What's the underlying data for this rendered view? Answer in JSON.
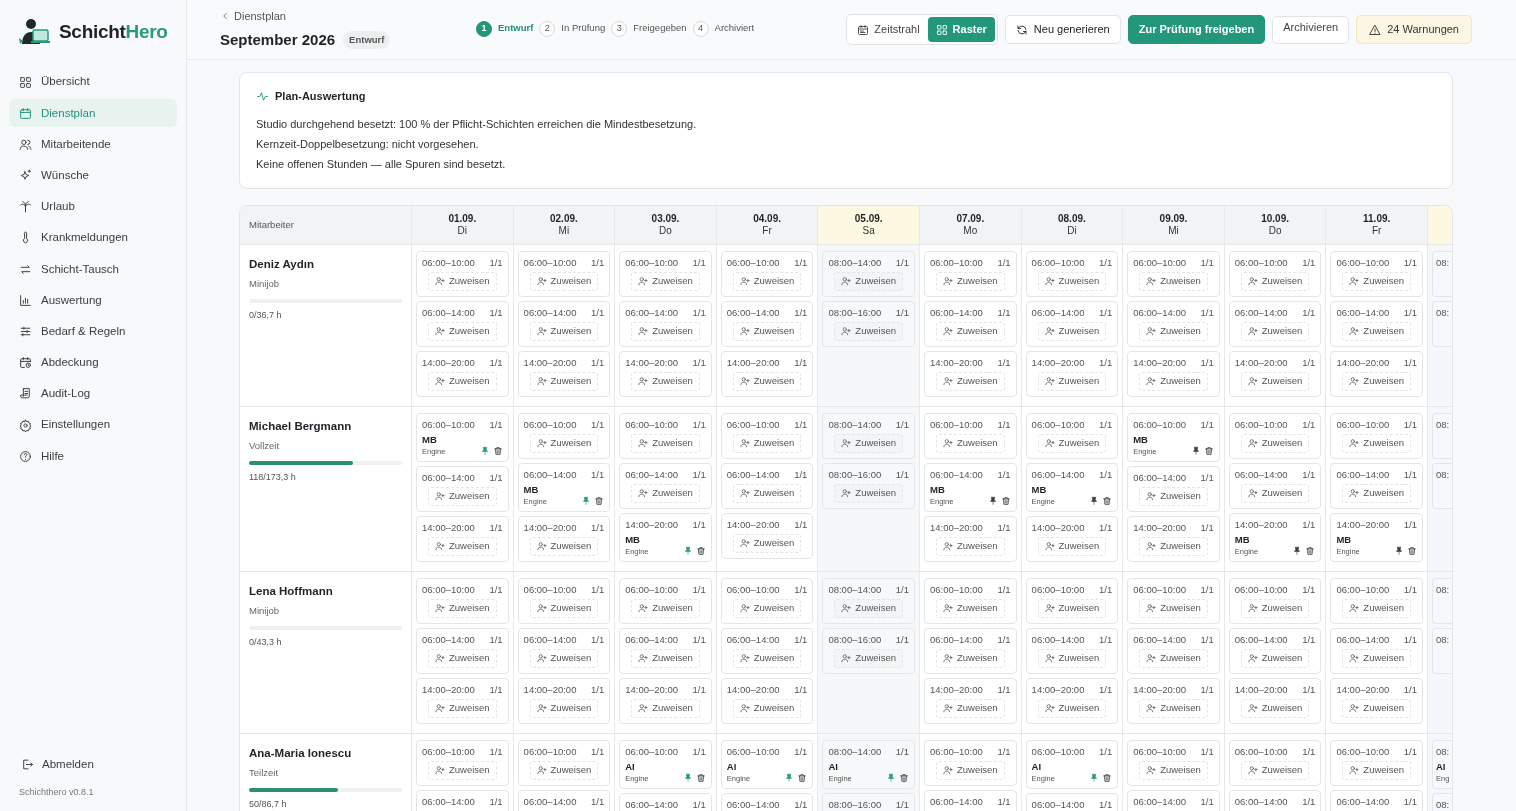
{
  "brand": {
    "name_dark": "Schicht",
    "name_accent": "Hero"
  },
  "sidebar": {
    "items": [
      {
        "label": "Übersicht",
        "selected": false
      },
      {
        "label": "Dienstplan",
        "selected": true
      },
      {
        "label": "Mitarbeitende",
        "selected": false
      },
      {
        "label": "Wünsche",
        "selected": false
      },
      {
        "label": "Urlaub",
        "selected": false
      },
      {
        "label": "Krankmeldungen",
        "selected": false
      },
      {
        "label": "Schicht-Tausch",
        "selected": false
      },
      {
        "label": "Auswertung",
        "selected": false
      },
      {
        "label": "Bedarf & Regeln",
        "selected": false
      },
      {
        "label": "Abdeckung",
        "selected": false
      },
      {
        "label": "Audit-Log",
        "selected": false
      },
      {
        "label": "Einstellungen",
        "selected": false
      },
      {
        "label": "Hilfe",
        "selected": false
      }
    ],
    "logout": "Abmelden",
    "version": "Schichthero v0.8.1"
  },
  "header": {
    "back": "Dienstplan",
    "title": "September 2026",
    "status": "Entwurf",
    "steps": [
      {
        "number": "1",
        "label": "Entwurf",
        "selected": true
      },
      {
        "number": "2",
        "label": "In Prüfung",
        "selected": false
      },
      {
        "number": "3",
        "label": "Freigegeben",
        "selected": false
      },
      {
        "number": "4",
        "label": "Archiviert",
        "selected": false
      }
    ],
    "views": [
      {
        "label": "Zeitstrahl",
        "selected": false
      },
      {
        "label": "Raster",
        "selected": true
      }
    ],
    "regenerate": "Neu generieren",
    "submit": "Zur Prüfung freigeben",
    "archive": "Archivieren",
    "warnings": "24 Warnungen"
  },
  "evaluation": {
    "title": "Plan-Auswertung",
    "lines": [
      "Studio durchgehend besetzt: 100 % der Pflicht-Schichten erreichen die Mindestbesetzung.",
      "Kernzeit-Doppelbesetzung: nicht vorgesehen.",
      "Keine offenen Stunden — alle Spuren sind besetzt."
    ]
  },
  "grid": {
    "employee_header": "Mitarbeiter",
    "days": [
      {
        "date": "01.09.",
        "weekday": "Di",
        "weekend": false
      },
      {
        "date": "02.09.",
        "weekday": "Mi",
        "weekend": false
      },
      {
        "date": "03.09.",
        "weekday": "Do",
        "weekend": false
      },
      {
        "date": "04.09.",
        "weekday": "Fr",
        "weekend": false
      },
      {
        "date": "05.09.",
        "weekday": "Sa",
        "weekend": true
      },
      {
        "date": "07.09.",
        "weekday": "Mo",
        "weekend": false
      },
      {
        "date": "08.09.",
        "weekday": "Di",
        "weekend": false
      },
      {
        "date": "09.09.",
        "weekday": "Mi",
        "weekend": false
      },
      {
        "date": "10.09.",
        "weekday": "Do",
        "weekend": false
      },
      {
        "date": "11.09.",
        "weekday": "Fr",
        "weekend": false
      },
      {
        "weekend": true,
        "partial": true
      }
    ],
    "rows": [
      {
        "name": "Deniz Aydın",
        "contract": "Minijob",
        "level": 0,
        "hours": "0/36,7 h",
        "slots": [
          [
            {
              "kind": "open",
              "time": "06:00–10:00",
              "count": "1/1",
              "action": "Zuweisen"
            },
            {
              "kind": "open",
              "time": "06:00–14:00",
              "count": "1/1",
              "action": "Zuweisen"
            },
            {
              "kind": "open",
              "time": "14:00–20:00",
              "count": "1/1",
              "action": "Zuweisen"
            }
          ],
          [
            {
              "kind": "open",
              "time": "06:00–10:00",
              "count": "1/1",
              "action": "Zuweisen"
            },
            {
              "kind": "open",
              "time": "06:00–14:00",
              "count": "1/1",
              "action": "Zuweisen"
            },
            {
              "kind": "open",
              "time": "14:00–20:00",
              "count": "1/1",
              "action": "Zuweisen"
            }
          ],
          [
            {
              "kind": "open",
              "time": "06:00–10:00",
              "count": "1/1",
              "action": "Zuweisen"
            },
            {
              "kind": "open",
              "time": "06:00–14:00",
              "count": "1/1",
              "action": "Zuweisen"
            },
            {
              "kind": "open",
              "time": "14:00–20:00",
              "count": "1/1",
              "action": "Zuweisen"
            }
          ],
          [
            {
              "kind": "open",
              "time": "06:00–10:00",
              "count": "1/1",
              "action": "Zuweisen"
            },
            {
              "kind": "open",
              "time": "06:00–14:00",
              "count": "1/1",
              "action": "Zuweisen"
            },
            {
              "kind": "open",
              "time": "14:00–20:00",
              "count": "1/1",
              "action": "Zuweisen"
            }
          ],
          [
            {
              "kind": "open",
              "time": "08:00–14:00",
              "count": "1/1",
              "action": "Zuweisen"
            },
            {
              "kind": "open",
              "time": "08:00–16:00",
              "count": "1/1",
              "action": "Zuweisen"
            }
          ],
          [
            {
              "kind": "open",
              "time": "06:00–10:00",
              "count": "1/1",
              "action": "Zuweisen"
            },
            {
              "kind": "open",
              "time": "06:00–14:00",
              "count": "1/1",
              "action": "Zuweisen"
            },
            {
              "kind": "open",
              "time": "14:00–20:00",
              "count": "1/1",
              "action": "Zuweisen"
            }
          ],
          [
            {
              "kind": "open",
              "time": "06:00–10:00",
              "count": "1/1",
              "action": "Zuweisen"
            },
            {
              "kind": "open",
              "time": "06:00–14:00",
              "count": "1/1",
              "action": "Zuweisen"
            },
            {
              "kind": "open",
              "time": "14:00–20:00",
              "count": "1/1",
              "action": "Zuweisen"
            }
          ],
          [
            {
              "kind": "open",
              "time": "06:00–10:00",
              "count": "1/1",
              "action": "Zuweisen"
            },
            {
              "kind": "open",
              "time": "06:00–14:00",
              "count": "1/1",
              "action": "Zuweisen"
            },
            {
              "kind": "open",
              "time": "14:00–20:00",
              "count": "1/1",
              "action": "Zuweisen"
            }
          ],
          [
            {
              "kind": "open",
              "time": "06:00–10:00",
              "count": "1/1",
              "action": "Zuweisen"
            },
            {
              "kind": "open",
              "time": "06:00–14:00",
              "count": "1/1",
              "action": "Zuweisen"
            },
            {
              "kind": "open",
              "time": "14:00–20:00",
              "count": "1/1",
              "action": "Zuweisen"
            }
          ],
          [
            {
              "kind": "open",
              "time": "06:00–10:00",
              "count": "1/1",
              "action": "Zuweisen"
            },
            {
              "kind": "open",
              "time": "06:00–14:00",
              "count": "1/1",
              "action": "Zuweisen"
            },
            {
              "kind": "open",
              "time": "14:00–20:00",
              "count": "1/1",
              "action": "Zuweisen"
            }
          ],
          [
            {
              "kind": "cut",
              "time": "08:"
            },
            {
              "kind": "cut",
              "time": "08:"
            }
          ]
        ]
      },
      {
        "name": "Michael Bergmann",
        "contract": "Vollzeit",
        "level": 0.68,
        "hours": "118/173,3 h",
        "slots": [
          [
            {
              "kind": "assigned",
              "time": "06:00–10:00",
              "count": "1/1",
              "initials": "MB",
              "source": "Engine",
              "pinned": true
            },
            {
              "kind": "open",
              "time": "06:00–14:00",
              "count": "1/1",
              "action": "Zuweisen"
            },
            {
              "kind": "open",
              "time": "14:00–20:00",
              "count": "1/1",
              "action": "Zuweisen"
            }
          ],
          [
            {
              "kind": "open",
              "time": "06:00–10:00",
              "count": "1/1",
              "action": "Zuweisen"
            },
            {
              "kind": "assigned",
              "time": "06:00–14:00",
              "count": "1/1",
              "initials": "MB",
              "source": "Engine",
              "pinned": true
            },
            {
              "kind": "open",
              "time": "14:00–20:00",
              "count": "1/1",
              "action": "Zuweisen"
            }
          ],
          [
            {
              "kind": "open",
              "time": "06:00–10:00",
              "count": "1/1",
              "action": "Zuweisen"
            },
            {
              "kind": "open",
              "time": "06:00–14:00",
              "count": "1/1",
              "action": "Zuweisen"
            },
            {
              "kind": "assigned",
              "time": "14:00–20:00",
              "count": "1/1",
              "initials": "MB",
              "source": "Engine",
              "pinned": true
            }
          ],
          [
            {
              "kind": "open",
              "time": "06:00–10:00",
              "count": "1/1",
              "action": "Zuweisen"
            },
            {
              "kind": "open",
              "time": "06:00–14:00",
              "count": "1/1",
              "action": "Zuweisen"
            },
            {
              "kind": "open",
              "time": "14:00–20:00",
              "count": "1/1",
              "action": "Zuweisen"
            }
          ],
          [
            {
              "kind": "open",
              "time": "08:00–14:00",
              "count": "1/1",
              "action": "Zuweisen"
            },
            {
              "kind": "open",
              "time": "08:00–16:00",
              "count": "1/1",
              "action": "Zuweisen"
            }
          ],
          [
            {
              "kind": "open",
              "time": "06:00–10:00",
              "count": "1/1",
              "action": "Zuweisen"
            },
            {
              "kind": "assigned",
              "time": "06:00–14:00",
              "count": "1/1",
              "initials": "MB",
              "source": "Engine",
              "pinned": false
            },
            {
              "kind": "open",
              "time": "14:00–20:00",
              "count": "1/1",
              "action": "Zuweisen"
            }
          ],
          [
            {
              "kind": "open",
              "time": "06:00–10:00",
              "count": "1/1",
              "action": "Zuweisen"
            },
            {
              "kind": "assigned",
              "time": "06:00–14:00",
              "count": "1/1",
              "initials": "MB",
              "source": "Engine",
              "pinned": false
            },
            {
              "kind": "open",
              "time": "14:00–20:00",
              "count": "1/1",
              "action": "Zuweisen"
            }
          ],
          [
            {
              "kind": "assigned",
              "time": "06:00–10:00",
              "count": "1/1",
              "initials": "MB",
              "source": "Engine",
              "pinned": false
            },
            {
              "kind": "open",
              "time": "06:00–14:00",
              "count": "1/1",
              "action": "Zuweisen"
            },
            {
              "kind": "open",
              "time": "14:00–20:00",
              "count": "1/1",
              "action": "Zuweisen"
            }
          ],
          [
            {
              "kind": "open",
              "time": "06:00–10:00",
              "count": "1/1",
              "action": "Zuweisen"
            },
            {
              "kind": "open",
              "time": "06:00–14:00",
              "count": "1/1",
              "action": "Zuweisen"
            },
            {
              "kind": "assigned",
              "time": "14:00–20:00",
              "count": "1/1",
              "initials": "MB",
              "source": "Engine",
              "pinned": false
            }
          ],
          [
            {
              "kind": "open",
              "time": "06:00–10:00",
              "count": "1/1",
              "action": "Zuweisen"
            },
            {
              "kind": "open",
              "time": "06:00–14:00",
              "count": "1/1",
              "action": "Zuweisen"
            },
            {
              "kind": "assigned",
              "time": "14:00–20:00",
              "count": "1/1",
              "initials": "MB",
              "source": "Engine",
              "pinned": false
            }
          ],
          [
            {
              "kind": "cut",
              "time": "08:"
            },
            {
              "kind": "cut",
              "time": "08:"
            }
          ]
        ]
      },
      {
        "name": "Lena Hoffmann",
        "contract": "Minijob",
        "level": 0,
        "hours": "0/43,3 h",
        "slots": [
          [
            {
              "kind": "open",
              "time": "06:00–10:00",
              "count": "1/1",
              "action": "Zuweisen"
            },
            {
              "kind": "open",
              "time": "06:00–14:00",
              "count": "1/1",
              "action": "Zuweisen"
            },
            {
              "kind": "open",
              "time": "14:00–20:00",
              "count": "1/1",
              "action": "Zuweisen"
            }
          ],
          [
            {
              "kind": "open",
              "time": "06:00–10:00",
              "count": "1/1",
              "action": "Zuweisen"
            },
            {
              "kind": "open",
              "time": "06:00–14:00",
              "count": "1/1",
              "action": "Zuweisen"
            },
            {
              "kind": "open",
              "time": "14:00–20:00",
              "count": "1/1",
              "action": "Zuweisen"
            }
          ],
          [
            {
              "kind": "open",
              "time": "06:00–10:00",
              "count": "1/1",
              "action": "Zuweisen"
            },
            {
              "kind": "open",
              "time": "06:00–14:00",
              "count": "1/1",
              "action": "Zuweisen"
            },
            {
              "kind": "open",
              "time": "14:00–20:00",
              "count": "1/1",
              "action": "Zuweisen"
            }
          ],
          [
            {
              "kind": "open",
              "time": "06:00–10:00",
              "count": "1/1",
              "action": "Zuweisen"
            },
            {
              "kind": "open",
              "time": "06:00–14:00",
              "count": "1/1",
              "action": "Zuweisen"
            },
            {
              "kind": "open",
              "time": "14:00–20:00",
              "count": "1/1",
              "action": "Zuweisen"
            }
          ],
          [
            {
              "kind": "open",
              "time": "08:00–14:00",
              "count": "1/1",
              "action": "Zuweisen"
            },
            {
              "kind": "open",
              "time": "08:00–16:00",
              "count": "1/1",
              "action": "Zuweisen"
            }
          ],
          [
            {
              "kind": "open",
              "time": "06:00–10:00",
              "count": "1/1",
              "action": "Zuweisen"
            },
            {
              "kind": "open",
              "time": "06:00–14:00",
              "count": "1/1",
              "action": "Zuweisen"
            },
            {
              "kind": "open",
              "time": "14:00–20:00",
              "count": "1/1",
              "action": "Zuweisen"
            }
          ],
          [
            {
              "kind": "open",
              "time": "06:00–10:00",
              "count": "1/1",
              "action": "Zuweisen"
            },
            {
              "kind": "open",
              "time": "06:00–14:00",
              "count": "1/1",
              "action": "Zuweisen"
            },
            {
              "kind": "open",
              "time": "14:00–20:00",
              "count": "1/1",
              "action": "Zuweisen"
            }
          ],
          [
            {
              "kind": "open",
              "time": "06:00–10:00",
              "count": "1/1",
              "action": "Zuweisen"
            },
            {
              "kind": "open",
              "time": "06:00–14:00",
              "count": "1/1",
              "action": "Zuweisen"
            },
            {
              "kind": "open",
              "time": "14:00–20:00",
              "count": "1/1",
              "action": "Zuweisen"
            }
          ],
          [
            {
              "kind": "open",
              "time": "06:00–10:00",
              "count": "1/1",
              "action": "Zuweisen"
            },
            {
              "kind": "open",
              "time": "06:00–14:00",
              "count": "1/1",
              "action": "Zuweisen"
            },
            {
              "kind": "open",
              "time": "14:00–20:00",
              "count": "1/1",
              "action": "Zuweisen"
            }
          ],
          [
            {
              "kind": "open",
              "time": "06:00–10:00",
              "count": "1/1",
              "action": "Zuweisen"
            },
            {
              "kind": "open",
              "time": "06:00–14:00",
              "count": "1/1",
              "action": "Zuweisen"
            },
            {
              "kind": "open",
              "time": "14:00–20:00",
              "count": "1/1",
              "action": "Zuweisen"
            }
          ],
          [
            {
              "kind": "cut",
              "time": "08:"
            },
            {
              "kind": "cut",
              "time": "08:"
            }
          ]
        ]
      },
      {
        "name": "Ana-Maria Ionescu",
        "contract": "Teilzeit",
        "level": 0.58,
        "hours": "50/86,7 h",
        "slots": [
          [
            {
              "kind": "open",
              "time": "06:00–10:00",
              "count": "1/1",
              "action": "Zuweisen"
            },
            {
              "kind": "cut",
              "time": "06:00–14:00",
              "count": "1/1"
            }
          ],
          [
            {
              "kind": "open",
              "time": "06:00–10:00",
              "count": "1/1",
              "action": "Zuweisen"
            },
            {
              "kind": "cut",
              "time": "06:00–14:00",
              "count": "1/1"
            }
          ],
          [
            {
              "kind": "assigned",
              "time": "06:00–10:00",
              "count": "1/1",
              "initials": "AI",
              "source": "Engine",
              "pinned": true
            },
            {
              "kind": "cut",
              "time": "06:00–14:00",
              "count": "1/1"
            }
          ],
          [
            {
              "kind": "assigned",
              "time": "06:00–10:00",
              "count": "1/1",
              "initials": "AI",
              "source": "Engine",
              "pinned": true
            },
            {
              "kind": "cut",
              "time": "06:00–14:00",
              "count": "1/1"
            }
          ],
          [
            {
              "kind": "assigned",
              "time": "08:00–14:00",
              "count": "1/1",
              "initials": "AI",
              "source": "Engine",
              "pinned": true
            },
            {
              "kind": "cut",
              "time": "08:00–16:00",
              "count": "1/1"
            }
          ],
          [
            {
              "kind": "open",
              "time": "06:00–10:00",
              "count": "1/1",
              "action": "Zuweisen"
            },
            {
              "kind": "cut",
              "time": "06:00–14:00",
              "count": "1/1"
            }
          ],
          [
            {
              "kind": "assigned",
              "time": "06:00–10:00",
              "count": "1/1",
              "initials": "AI",
              "source": "Engine",
              "pinned": true
            },
            {
              "kind": "cut",
              "time": "06:00–14:00",
              "count": "1/1"
            }
          ],
          [
            {
              "kind": "open",
              "time": "06:00–10:00",
              "count": "1/1",
              "action": "Zuweisen"
            },
            {
              "kind": "cut",
              "time": "06:00–14:00",
              "count": "1/1"
            }
          ],
          [
            {
              "kind": "open",
              "time": "06:00–10:00",
              "count": "1/1",
              "action": "Zuweisen"
            },
            {
              "kind": "cut",
              "time": "06:00–14:00",
              "count": "1/1"
            }
          ],
          [
            {
              "kind": "open",
              "time": "06:00–10:00",
              "count": "1/1",
              "action": "Zuweisen"
            },
            {
              "kind": "cut",
              "time": "06:00–14:00",
              "count": "1/1"
            }
          ],
          [
            {
              "kind": "assigned",
              "time": "08:",
              "initials": "AI",
              "source": "Eng"
            },
            {
              "kind": "cut",
              "time": "08:"
            }
          ]
        ]
      }
    ]
  }
}
